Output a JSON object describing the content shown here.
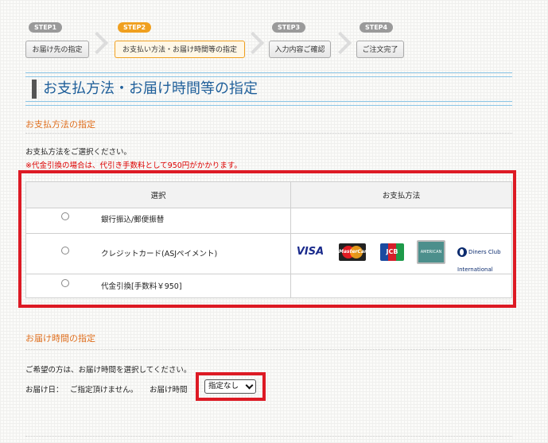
{
  "steps": [
    {
      "tag": "STEP1",
      "label": "お届け先の指定"
    },
    {
      "tag": "STEP2",
      "label": "お支払い方法・お届け時間等の指定"
    },
    {
      "tag": "STEP3",
      "label": "入力内容ご確認"
    },
    {
      "tag": "STEP4",
      "label": "ご注文完了"
    }
  ],
  "page_title": "お支払方法・お届け時間等の指定",
  "payment": {
    "section_title": "お支払方法の指定",
    "instruction": "お支払方法をご選択ください。",
    "warning": "※代金引換の場合は、代引き手数料として950円がかかります。",
    "headers": {
      "select": "選択",
      "method": "お支払方法"
    },
    "options": [
      {
        "label": "銀行振込/郵便振替"
      },
      {
        "label": "クレジットカード(ASJペイメント)"
      },
      {
        "label": "代金引換[手数料￥950]"
      }
    ],
    "cards": {
      "visa": "VISA",
      "mastercard": "MasterCard",
      "jcb": "JCB",
      "amex": "AMERICAN EXPRESS",
      "diners": "Diners Club International"
    }
  },
  "delivery": {
    "section_title": "お届け時間の指定",
    "instruction": "ご希望の方は、お届け時間を選択してください。",
    "date_label": "お届け日：",
    "date_value": "ご指定頂けません。",
    "time_label": "お届け時間",
    "time_value": "指定なし"
  },
  "colors": {
    "accent_orange": "#e07020",
    "title_blue": "#1f5f9a",
    "highlight_red": "#dd1a24",
    "warning_red": "#dd0000"
  }
}
